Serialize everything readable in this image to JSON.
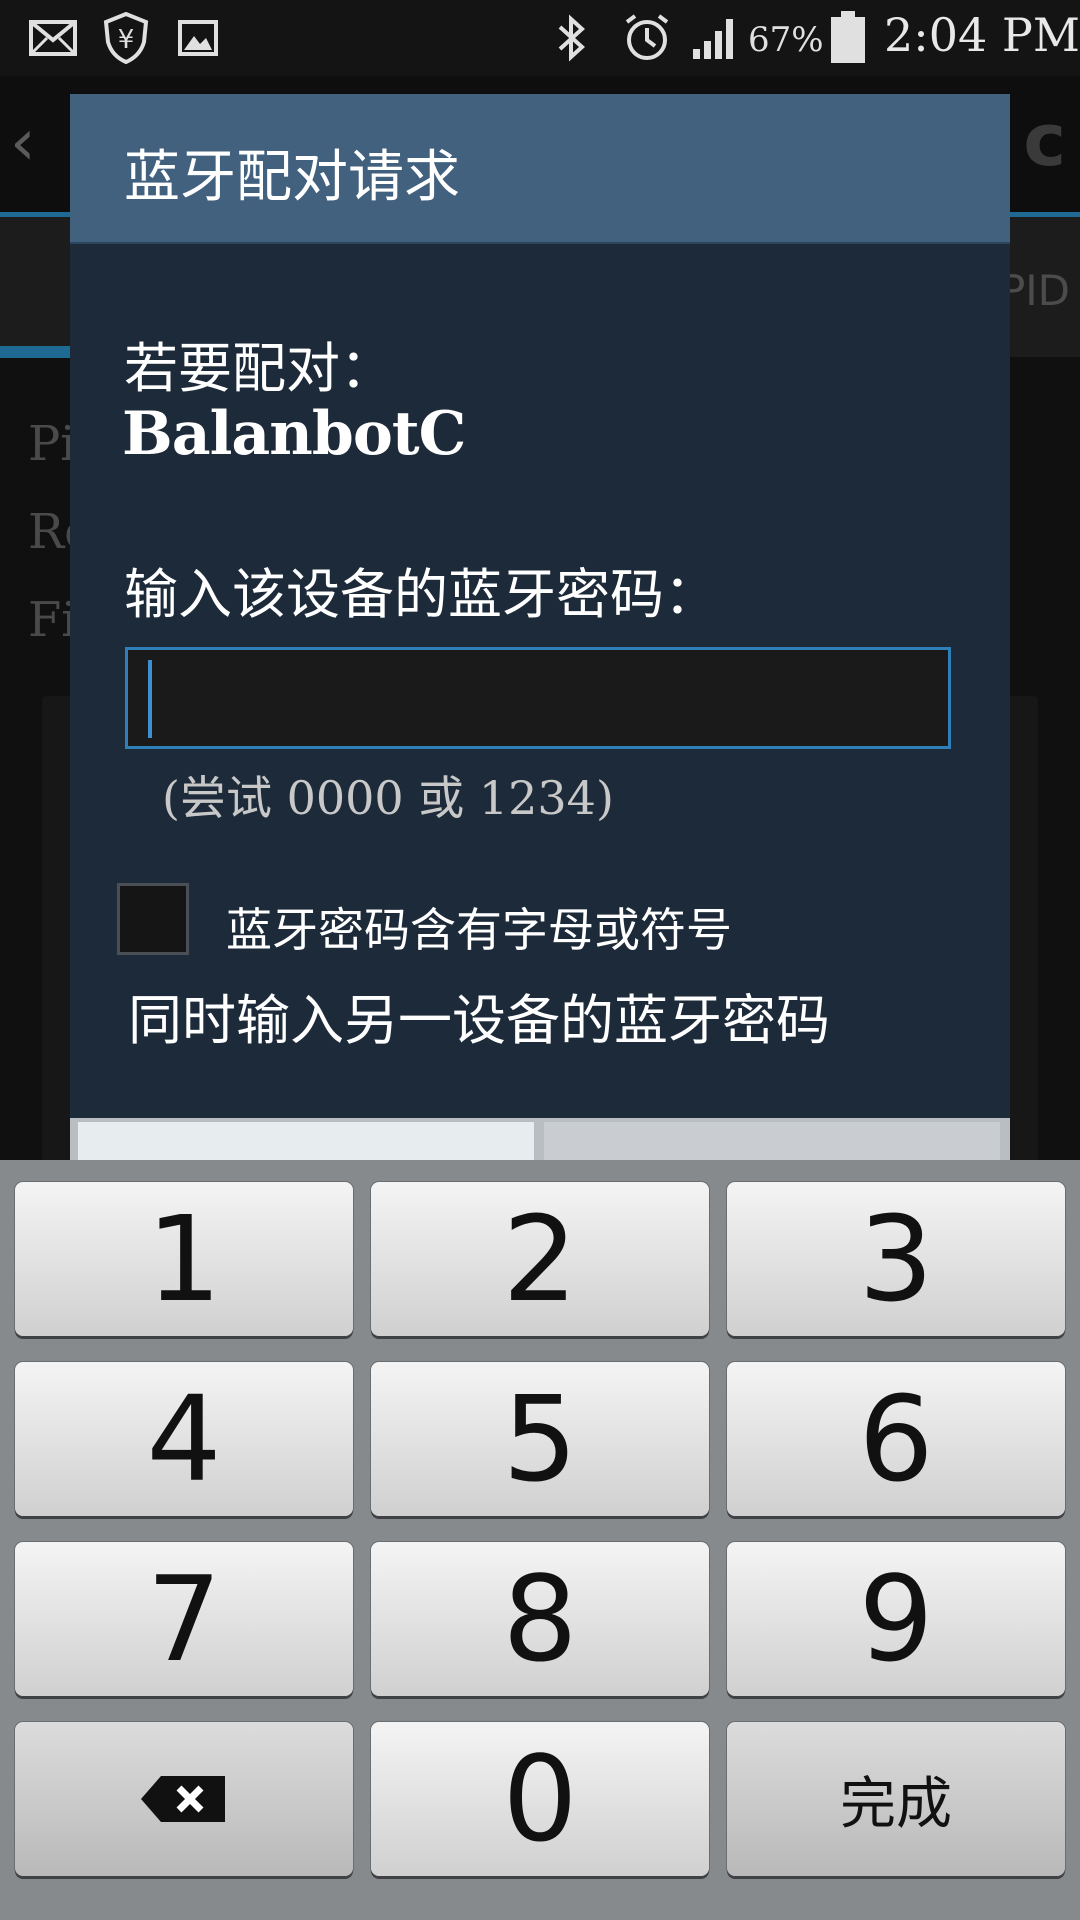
{
  "status_bar": {
    "battery_percent": "67%",
    "time": "2:04 PM",
    "icons": [
      "mail-icon",
      "security-shield-icon",
      "image-icon",
      "bluetooth-icon",
      "alarm-icon",
      "signal-icon",
      "battery-icon"
    ]
  },
  "background_app": {
    "back_glyph": "‹",
    "title_fragment": "c",
    "tab_fragment": "PID",
    "row_fragments": [
      "Pi",
      "Ro",
      "Fi"
    ]
  },
  "dialog": {
    "title": "蓝牙配对请求",
    "pair_prompt": "若要配对：",
    "device_name": "BalanbotC",
    "pin_prompt": "输入该设备的蓝牙密码：",
    "pin_value": "",
    "pin_hint": "(尝试 0000 或 1234)",
    "checkbox_label": "蓝牙密码含有字母或符号",
    "checkbox_checked": false,
    "note": "同时输入另一设备的蓝牙密码"
  },
  "keypad": {
    "keys": [
      "1",
      "2",
      "3",
      "4",
      "5",
      "6",
      "7",
      "8",
      "9"
    ],
    "zero": "0",
    "done_label": "完成",
    "backspace_icon": "backspace-icon"
  }
}
